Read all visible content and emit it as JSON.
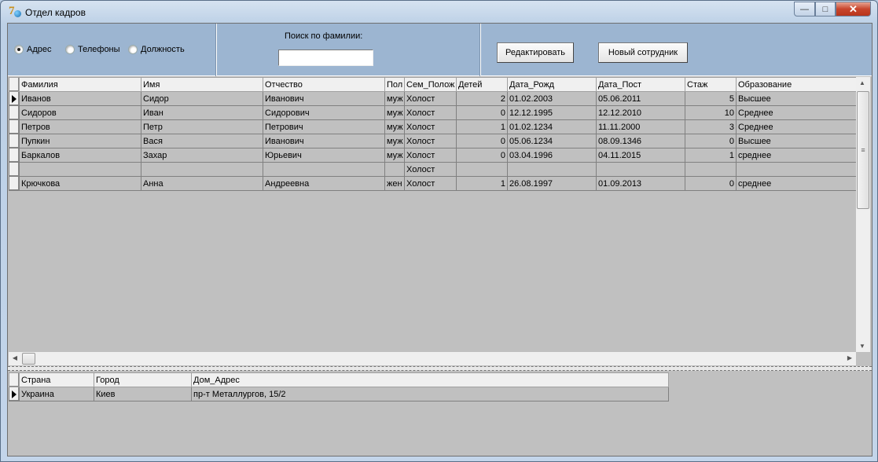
{
  "window": {
    "title": "Отдел кадров",
    "minimize": "—",
    "maximize": "□",
    "close": "✕"
  },
  "toolbar": {
    "radios": [
      {
        "label": "Адрес",
        "checked": true
      },
      {
        "label": "Телефоны",
        "checked": false
      },
      {
        "label": "Должность",
        "checked": false
      }
    ],
    "search_label": "Поиск по фамилии:",
    "search_value": "",
    "edit_button": "Редактировать",
    "new_button": "Новый сотрудник"
  },
  "employees": {
    "columns": [
      "Фамилия",
      "Имя",
      "Отчество",
      "Пол",
      "Сем_Полож",
      "Детей",
      "Дата_Рожд",
      "Дата_Пост",
      "Стаж",
      "Образование"
    ],
    "rows": [
      [
        "Иванов",
        "Сидор",
        "Иванович",
        "муж",
        "Холост",
        "2",
        "01.02.2003",
        "05.06.2011",
        "5",
        "Высшее"
      ],
      [
        "Сидоров",
        "Иван",
        "Сидорович",
        "муж",
        "Холост",
        "0",
        "12.12.1995",
        "12.12.2010",
        "10",
        "Среднее"
      ],
      [
        "Петров",
        "Петр",
        "Петрович",
        "муж",
        "Холост",
        "1",
        "01.02.1234",
        "11.11.2000",
        "3",
        "Среднее"
      ],
      [
        "Пупкин",
        "Вася",
        "Иванович",
        "муж",
        "Холост",
        "0",
        "05.06.1234",
        "08.09.1346",
        "0",
        "Высшее"
      ],
      [
        "Баркалов",
        "Захар",
        "Юрьевич",
        "муж",
        "Холост",
        "0",
        "03.04.1996",
        "04.11.2015",
        "1",
        "среднее"
      ],
      [
        "",
        "",
        "",
        "",
        "Холост",
        "",
        "",
        "",
        "",
        ""
      ],
      [
        "Крючкова",
        "Анна",
        "Андреевна",
        "жен",
        "Холост",
        "1",
        "26.08.1997",
        "01.09.2013",
        "0",
        "среднее"
      ]
    ],
    "current_row": 0
  },
  "address": {
    "columns": [
      "Страна",
      "Город",
      "Дом_Адрес"
    ],
    "rows": [
      [
        "Украина",
        "Киев",
        "пр-т Металлургов, 15/2"
      ]
    ]
  }
}
